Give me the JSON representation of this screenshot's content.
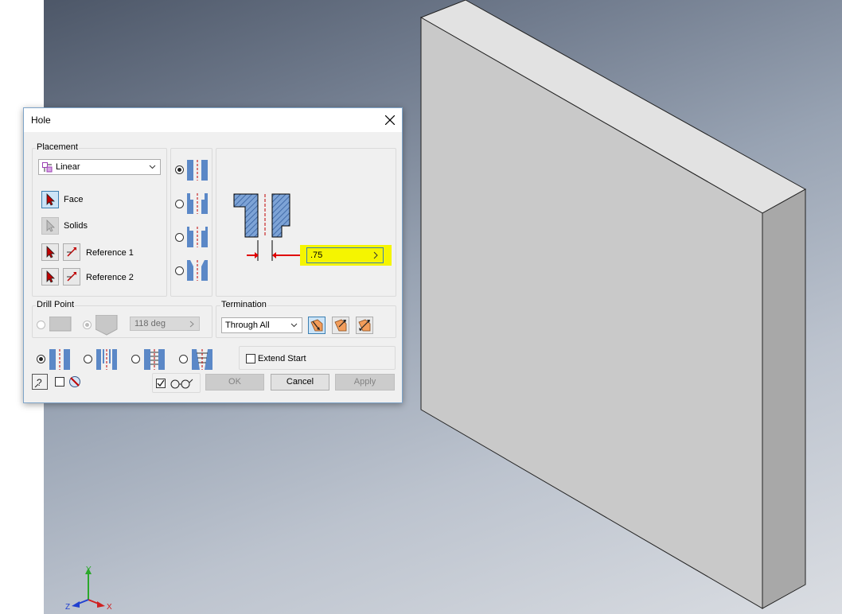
{
  "dialog": {
    "title": "Hole",
    "placement": {
      "group_label": "Placement",
      "type_value": "Linear",
      "face_label": "Face",
      "solids_label": "Solids",
      "reference1_label": "Reference 1",
      "reference2_label": "Reference 2"
    },
    "hole_types": [
      "Drilled",
      "Counterbore",
      "Spotface",
      "Countersink"
    ],
    "diameter_value": ".75",
    "drill_point": {
      "group_label": "Drill Point",
      "angle_value": "118 deg"
    },
    "termination": {
      "group_label": "Termination",
      "value": "Through All"
    },
    "thread_options": [
      "Simple Hole",
      "Clearance Hole",
      "Tapped Hole",
      "Taper Tapped Hole"
    ],
    "extend_start_label": "Extend Start",
    "buttons": {
      "ok": "OK",
      "cancel": "Cancel",
      "apply": "Apply"
    }
  },
  "triad": {
    "x": "X",
    "y": "Y",
    "z": "Z"
  },
  "colors": {
    "accent": "#3c7fb1",
    "highlight": "#f5f500",
    "section_fill": "#4f7dbb",
    "arrow_red": "#e00000"
  }
}
